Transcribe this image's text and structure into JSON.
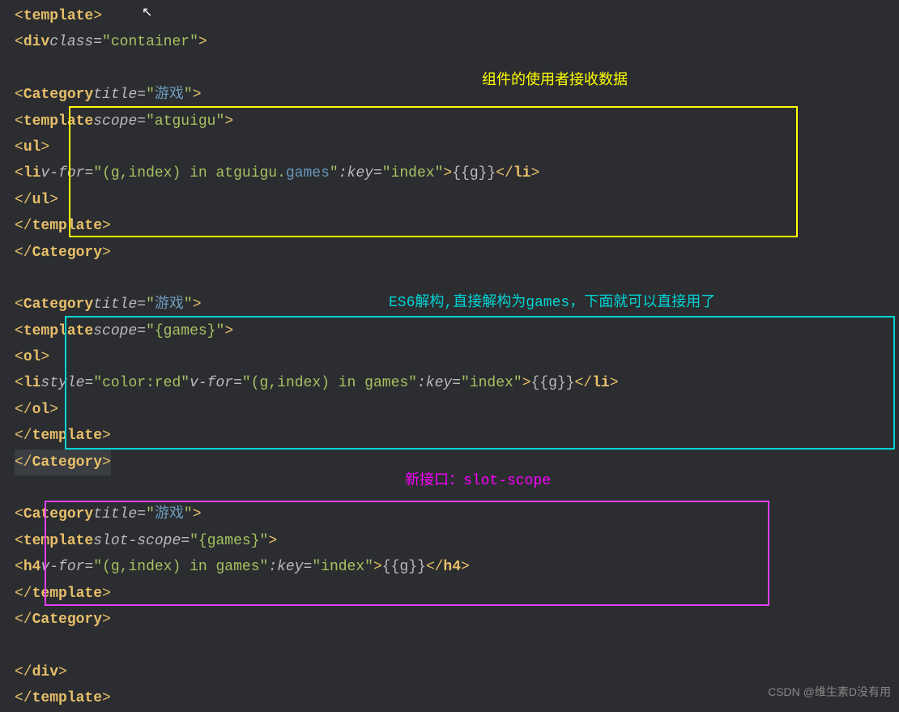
{
  "annotations": {
    "top": "组件的使用者接收数据",
    "middle": "ES6解构,直接解构为games，下面就可以直接用了",
    "bottom": "新接口：slot-scope"
  },
  "code": {
    "l1_tag": "template",
    "l2_tag": "div",
    "l2_attr": "class",
    "l2_val": "container",
    "cat_tag": "Category",
    "cat_attr": "title",
    "cat_val": "游戏",
    "tpl_tag": "template",
    "scope_attr": "scope",
    "scope_val1": "atguigu",
    "ul_tag": "ul",
    "li_tag": "li",
    "vfor_attr": "v-for",
    "vfor_val1": "(g,index) in atguigu.",
    "vfor_prop": "games",
    "key_attr": ":key",
    "key_val": "index",
    "mustache": "{{g}}",
    "scope_val2": "{games}",
    "ol_tag": "ol",
    "style_attr": "style",
    "style_val": "color:red",
    "vfor_val2": "(g,index) in games",
    "slotscope_attr": "slot-scope",
    "h4_tag": "h4",
    "in_kw": " in "
  },
  "watermark": "CSDN @维生素D没有用"
}
